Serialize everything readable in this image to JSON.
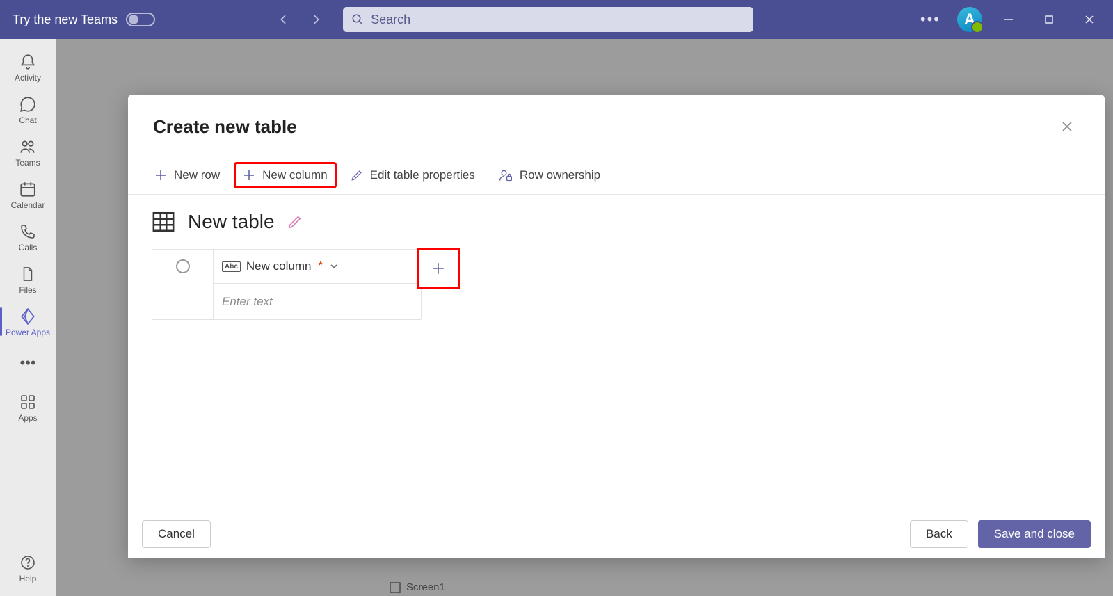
{
  "titlebar": {
    "try_new_label": "Try the new Teams",
    "search_placeholder": "Search",
    "avatar_initial": "A"
  },
  "rail": {
    "activity": "Activity",
    "chat": "Chat",
    "teams": "Teams",
    "calendar": "Calendar",
    "calls": "Calls",
    "files": "Files",
    "powerapps": "Power Apps",
    "apps": "Apps",
    "help": "Help"
  },
  "background": {
    "screen_label": "Screen1"
  },
  "modal": {
    "title": "Create new table",
    "toolbar": {
      "new_row": "New row",
      "new_column": "New column",
      "edit_props": "Edit table properties",
      "row_ownership": "Row ownership"
    },
    "table_name": "New table",
    "column_header": "New column",
    "enter_text_placeholder": "Enter text",
    "footer": {
      "cancel": "Cancel",
      "back": "Back",
      "save_close": "Save and close"
    }
  }
}
